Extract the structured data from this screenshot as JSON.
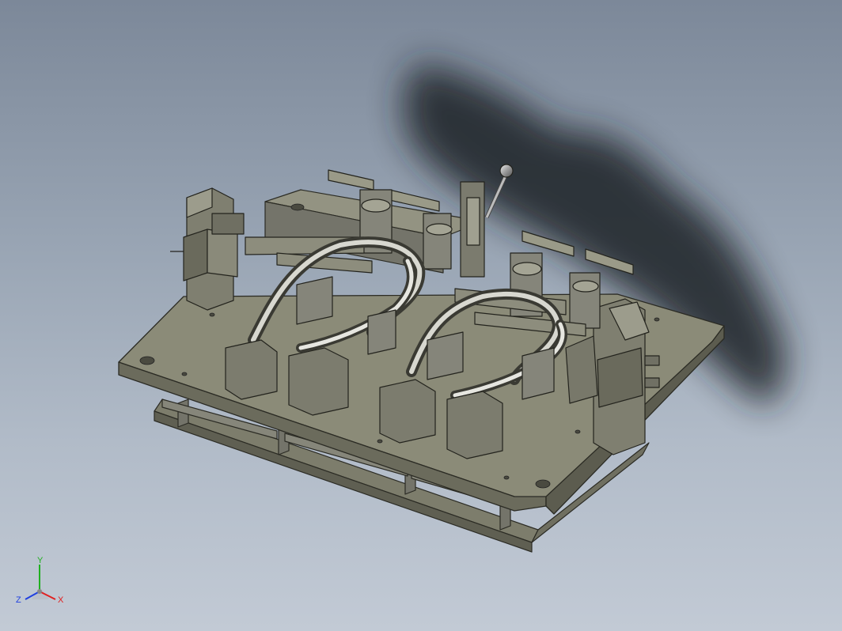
{
  "viewport": {
    "background_top": "#7c8899",
    "background_bottom": "#c2cad5",
    "model_color": "#8b8b78"
  },
  "triad": {
    "x_label": "X",
    "y_label": "Y",
    "z_label": "Z",
    "x_color": "#e02020",
    "y_color": "#20b020",
    "z_color": "#2040e0"
  }
}
